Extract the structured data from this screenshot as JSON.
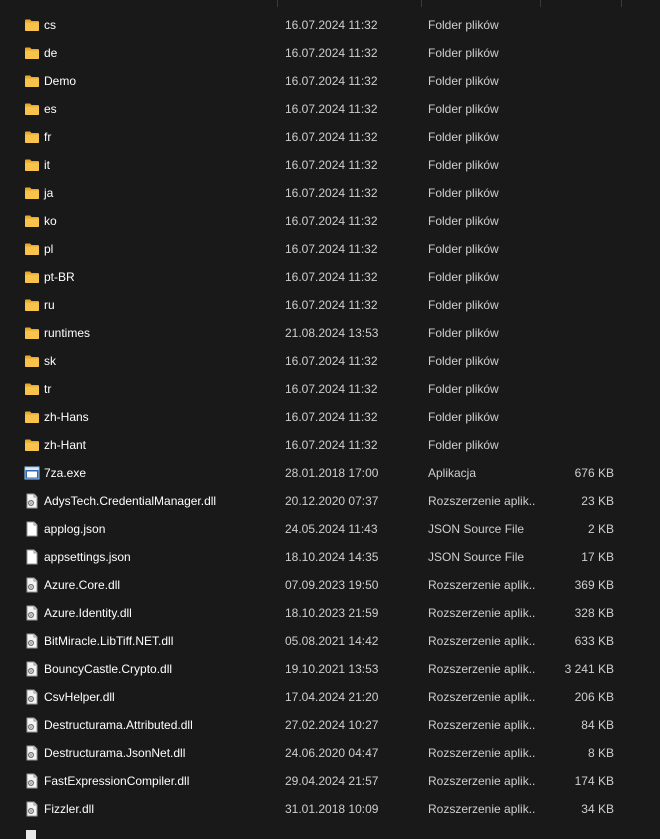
{
  "colors": {
    "background": "#191919",
    "folder_icon": "#f7c34a",
    "text_primary": "#ffffff",
    "text_secondary": "#cfcfcf"
  },
  "files": [
    {
      "name": "cs",
      "date": "16.07.2024 11:32",
      "type": "Folder plików",
      "size": "",
      "icon": "folder-icon"
    },
    {
      "name": "de",
      "date": "16.07.2024 11:32",
      "type": "Folder plików",
      "size": "",
      "icon": "folder-icon"
    },
    {
      "name": "Demo",
      "date": "16.07.2024 11:32",
      "type": "Folder plików",
      "size": "",
      "icon": "folder-icon"
    },
    {
      "name": "es",
      "date": "16.07.2024 11:32",
      "type": "Folder plików",
      "size": "",
      "icon": "folder-icon"
    },
    {
      "name": "fr",
      "date": "16.07.2024 11:32",
      "type": "Folder plików",
      "size": "",
      "icon": "folder-icon"
    },
    {
      "name": "it",
      "date": "16.07.2024 11:32",
      "type": "Folder plików",
      "size": "",
      "icon": "folder-icon"
    },
    {
      "name": "ja",
      "date": "16.07.2024 11:32",
      "type": "Folder plików",
      "size": "",
      "icon": "folder-icon"
    },
    {
      "name": "ko",
      "date": "16.07.2024 11:32",
      "type": "Folder plików",
      "size": "",
      "icon": "folder-icon"
    },
    {
      "name": "pl",
      "date": "16.07.2024 11:32",
      "type": "Folder plików",
      "size": "",
      "icon": "folder-icon"
    },
    {
      "name": "pt-BR",
      "date": "16.07.2024 11:32",
      "type": "Folder plików",
      "size": "",
      "icon": "folder-icon"
    },
    {
      "name": "ru",
      "date": "16.07.2024 11:32",
      "type": "Folder plików",
      "size": "",
      "icon": "folder-icon"
    },
    {
      "name": "runtimes",
      "date": "21.08.2024 13:53",
      "type": "Folder plików",
      "size": "",
      "icon": "folder-icon"
    },
    {
      "name": "sk",
      "date": "16.07.2024 11:32",
      "type": "Folder plików",
      "size": "",
      "icon": "folder-icon"
    },
    {
      "name": "tr",
      "date": "16.07.2024 11:32",
      "type": "Folder plików",
      "size": "",
      "icon": "folder-icon"
    },
    {
      "name": "zh-Hans",
      "date": "16.07.2024 11:32",
      "type": "Folder plików",
      "size": "",
      "icon": "folder-icon"
    },
    {
      "name": "zh-Hant",
      "date": "16.07.2024 11:32",
      "type": "Folder plików",
      "size": "",
      "icon": "folder-icon"
    },
    {
      "name": "7za.exe",
      "date": "28.01.2018 17:00",
      "type": "Aplikacja",
      "size": "676 KB",
      "icon": "application-icon"
    },
    {
      "name": "AdysTech.CredentialManager.dll",
      "date": "20.12.2020 07:37",
      "type": "Rozszerzenie aplik...",
      "size": "23 KB",
      "icon": "dll-file-icon"
    },
    {
      "name": "applog.json",
      "date": "24.05.2024 11:43",
      "type": "JSON Source File",
      "size": "2 KB",
      "icon": "json-file-icon"
    },
    {
      "name": "appsettings.json",
      "date": "18.10.2024 14:35",
      "type": "JSON Source File",
      "size": "17 KB",
      "icon": "json-file-icon"
    },
    {
      "name": "Azure.Core.dll",
      "date": "07.09.2023 19:50",
      "type": "Rozszerzenie aplik...",
      "size": "369 KB",
      "icon": "dll-file-icon"
    },
    {
      "name": "Azure.Identity.dll",
      "date": "18.10.2023 21:59",
      "type": "Rozszerzenie aplik...",
      "size": "328 KB",
      "icon": "dll-file-icon"
    },
    {
      "name": "BitMiracle.LibTiff.NET.dll",
      "date": "05.08.2021 14:42",
      "type": "Rozszerzenie aplik...",
      "size": "633 KB",
      "icon": "dll-file-icon"
    },
    {
      "name": "BouncyCastle.Crypto.dll",
      "date": "19.10.2021 13:53",
      "type": "Rozszerzenie aplik...",
      "size": "3 241 KB",
      "icon": "dll-file-icon"
    },
    {
      "name": "CsvHelper.dll",
      "date": "17.04.2024 21:20",
      "type": "Rozszerzenie aplik...",
      "size": "206 KB",
      "icon": "dll-file-icon"
    },
    {
      "name": "Destructurama.Attributed.dll",
      "date": "27.02.2024 10:27",
      "type": "Rozszerzenie aplik...",
      "size": "84 KB",
      "icon": "dll-file-icon"
    },
    {
      "name": "Destructurama.JsonNet.dll",
      "date": "24.06.2020 04:47",
      "type": "Rozszerzenie aplik...",
      "size": "8 KB",
      "icon": "dll-file-icon"
    },
    {
      "name": "FastExpressionCompiler.dll",
      "date": "29.04.2024 21:57",
      "type": "Rozszerzenie aplik...",
      "size": "174 KB",
      "icon": "dll-file-icon"
    },
    {
      "name": "Fizzler.dll",
      "date": "31.01.2018 10:09",
      "type": "Rozszerzenie aplik...",
      "size": "34 KB",
      "icon": "dll-file-icon"
    }
  ]
}
